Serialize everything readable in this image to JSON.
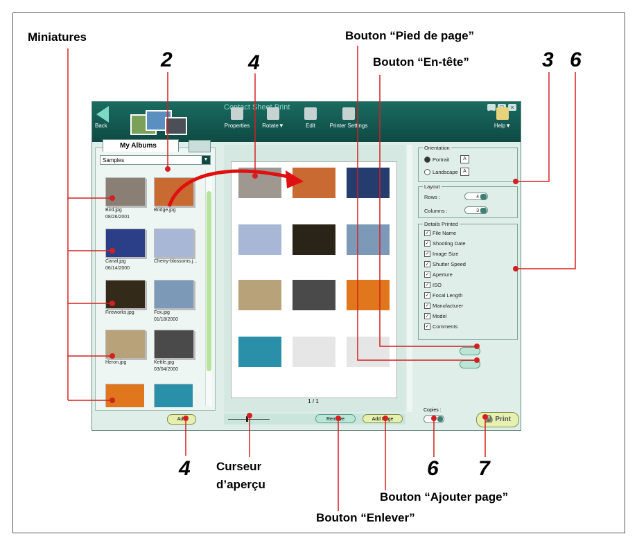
{
  "callouts": {
    "miniatures": "Miniatures",
    "footer_button": "Bouton “Pied de page”",
    "header_button": "Bouton “En-tête”",
    "preview_slider": "Curseur",
    "preview_slider_2": "d’aperçu",
    "add_page_button": "Bouton “Ajouter page”",
    "remove_button": "Bouton “Enlever”"
  },
  "numbers": {
    "n2": "2",
    "n4_top": "4",
    "n3": "3",
    "n6_top": "6",
    "n4_bottom": "4",
    "n6_bottom": "6",
    "n7": "7"
  },
  "app": {
    "title": "Contact Sheet Print",
    "back_label": "Back",
    "toolbar": {
      "properties": "Properties",
      "rotate": "Rotate▼",
      "edit": "Edit",
      "printer_settings": "Printer Settings",
      "help": "Help▼"
    },
    "left": {
      "tab_label": "My Albums",
      "album_select": "Samples",
      "thumbs": [
        {
          "name": "Bird.jpg",
          "date": "08/26/2001",
          "color": "#8a7f74"
        },
        {
          "name": "Bridge.jpg",
          "date": "",
          "color": "#c86a32"
        },
        {
          "name": "Canal.jpg",
          "date": "06/14/2000",
          "color": "#2a3f88"
        },
        {
          "name": "Cherry-blossoms.j...",
          "date": "",
          "color": "#a9b7d6"
        },
        {
          "name": "Fireworks.jpg",
          "date": "",
          "color": "#332a1a"
        },
        {
          "name": "Fox.jpg",
          "date": "01/18/2000",
          "color": "#7c9ab8"
        },
        {
          "name": "Heron.jpg",
          "date": "",
          "color": "#b8a27a"
        },
        {
          "name": "Kettle.jpg",
          "date": "03/04/2000",
          "color": "#4a4a4a"
        }
      ],
      "add_button": "Add"
    },
    "preview": {
      "page_number": "1 / 1",
      "remove_button": "Remove",
      "add_page_button": "Add Page"
    },
    "orientation": {
      "title": "Orientation",
      "portrait": "Portrait",
      "landscape": "Landscape",
      "icon_letter": "A"
    },
    "layout": {
      "title": "Layout",
      "rows_label": "Rows :",
      "rows_value": "4",
      "columns_label": "Columns :",
      "columns_value": "3"
    },
    "details": {
      "title": "Details Printed",
      "items": [
        "File Name",
        "Shooting Date",
        "Image Size",
        "Shutter Speed",
        "Aperture",
        "ISO",
        "Focal Length",
        "Manufacturer",
        "Model",
        "Comments"
      ]
    },
    "copies_label": "Copies :",
    "copies_value": "1",
    "print_button": "Print"
  }
}
